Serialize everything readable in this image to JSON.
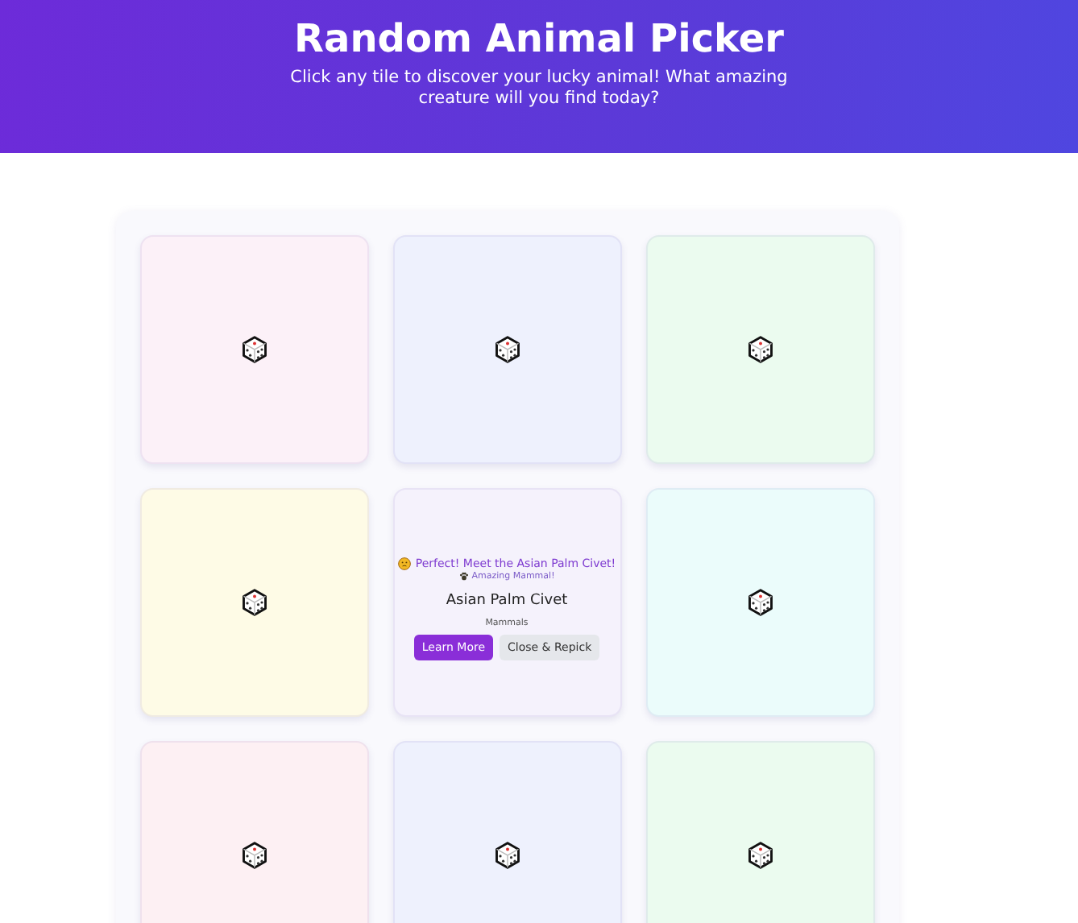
{
  "header": {
    "title": "Random Animal Picker",
    "subtitle": "Click any tile to discover your lucky animal! What amazing creature will you find today?"
  },
  "tiles": [
    {
      "kind": "hidden",
      "color": "#fcf1f8"
    },
    {
      "kind": "hidden",
      "color": "#eef1fd"
    },
    {
      "kind": "hidden",
      "color": "#ebfbef"
    },
    {
      "kind": "hidden",
      "color": "#fefbe6"
    },
    {
      "kind": "revealed",
      "color": "#f5f2fc",
      "message": "Perfect! Meet the Asian Palm Civet!",
      "badge": "Amazing Mammal!",
      "name": "Asian Palm Civet",
      "category": "Mammals",
      "buttons": [
        "Learn More",
        "Close & Repick"
      ]
    },
    {
      "kind": "hidden",
      "color": "#ebfcfb"
    },
    {
      "kind": "hidden",
      "color": "#fdf0f3"
    },
    {
      "kind": "hidden",
      "color": "#eef1fd"
    },
    {
      "kind": "hidden",
      "color": "#ebfbef"
    }
  ]
}
